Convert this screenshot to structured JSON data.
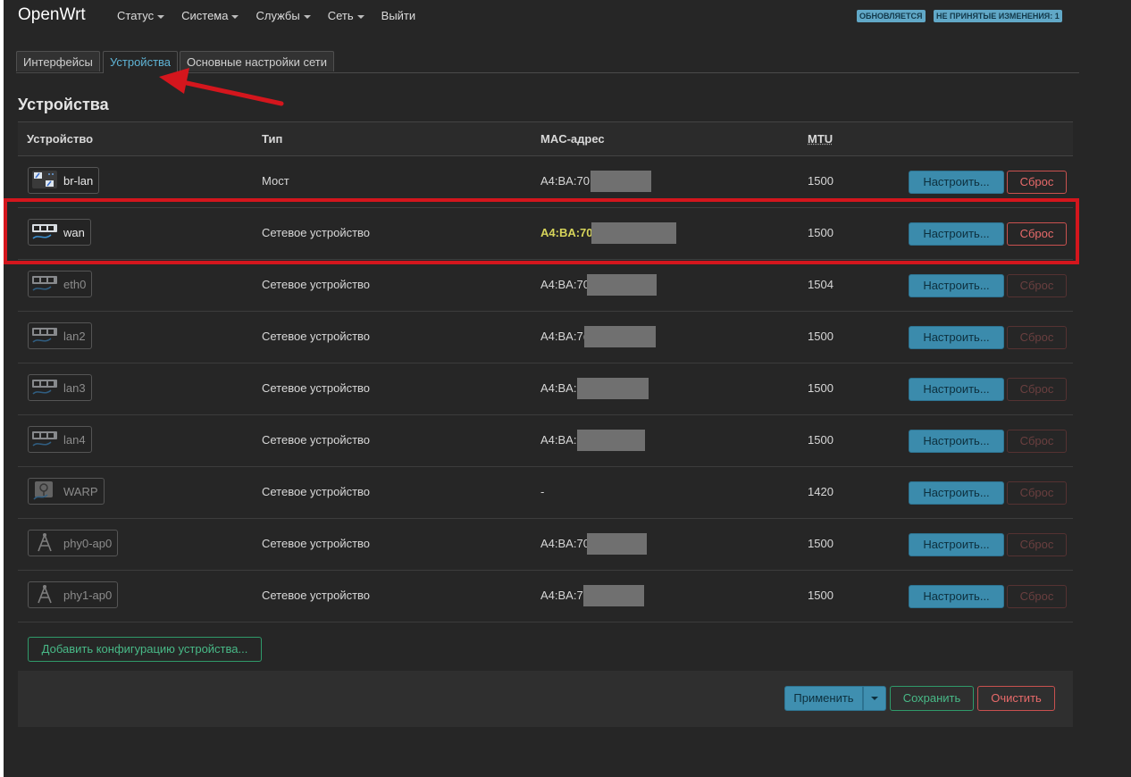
{
  "header": {
    "brand": "OpenWrt",
    "menu": [
      {
        "label": "Статус",
        "has_caret": true
      },
      {
        "label": "Система",
        "has_caret": true
      },
      {
        "label": "Службы",
        "has_caret": true
      },
      {
        "label": "Сеть",
        "has_caret": true
      },
      {
        "label": "Выйти",
        "has_caret": false
      }
    ],
    "badges": {
      "updating": "ОБНОВЛЯЕТСЯ",
      "unsaved": "НЕ ПРИНЯТЫЕ ИЗМЕНЕНИЯ: 1"
    }
  },
  "tabs": [
    {
      "label": "Интерфейсы",
      "active": false
    },
    {
      "label": "Устройства",
      "active": true
    },
    {
      "label": "Основные настройки сети",
      "active": false
    }
  ],
  "section_title": "Устройства",
  "table": {
    "headers": {
      "device": "Устройство",
      "type": "Тип",
      "mac": "MAC-адрес",
      "mtu": "MTU"
    },
    "edit_label": "Настроить...",
    "reset_label": "Сброс",
    "rows": [
      {
        "name": "br-lan",
        "icon": "bridge-icon",
        "type": "Мост",
        "mac": "A4:BA:70",
        "mtu": "1500"
      },
      {
        "name": "wan",
        "icon": "ethernet-icon",
        "type": "Сетевое устройство",
        "mac": "A4:BA:70",
        "mtu": "1500"
      },
      {
        "name": "eth0",
        "icon": "ethernet-icon",
        "type": "Сетевое устройство",
        "mac": "A4:BA:70",
        "mtu": "1504"
      },
      {
        "name": "lan2",
        "icon": "ethernet-icon",
        "type": "Сетевое устройство",
        "mac": "A4:BA:7(",
        "mtu": "1500"
      },
      {
        "name": "lan3",
        "icon": "ethernet-icon",
        "type": "Сетевое устройство",
        "mac": "A4:BA:",
        "mtu": "1500"
      },
      {
        "name": "lan4",
        "icon": "ethernet-icon",
        "type": "Сетевое устройство",
        "mac": "A4:BA:",
        "mtu": "1500"
      },
      {
        "name": "WARP",
        "icon": "tunnel-icon",
        "type": "Сетевое устройство",
        "mac": "-",
        "mtu": "1420"
      },
      {
        "name": "phy0-ap0",
        "icon": "wifi-antenna-icon",
        "type": "Сетевое устройство",
        "mac": "A4:BA:70",
        "mtu": "1500"
      },
      {
        "name": "phy1-ap0",
        "icon": "wifi-antenna-icon",
        "type": "Сетевое устройство",
        "mac": "A4:BA:7",
        "mtu": "1500"
      }
    ]
  },
  "add_device_label": "Добавить конфигурацию устройства...",
  "footer": {
    "apply": "Применить",
    "save": "Сохранить",
    "reset": "Очистить"
  },
  "colors": {
    "accent": "#3b8bac",
    "danger": "#d4161d",
    "success": "#2f9a6a",
    "background": "#262626"
  }
}
